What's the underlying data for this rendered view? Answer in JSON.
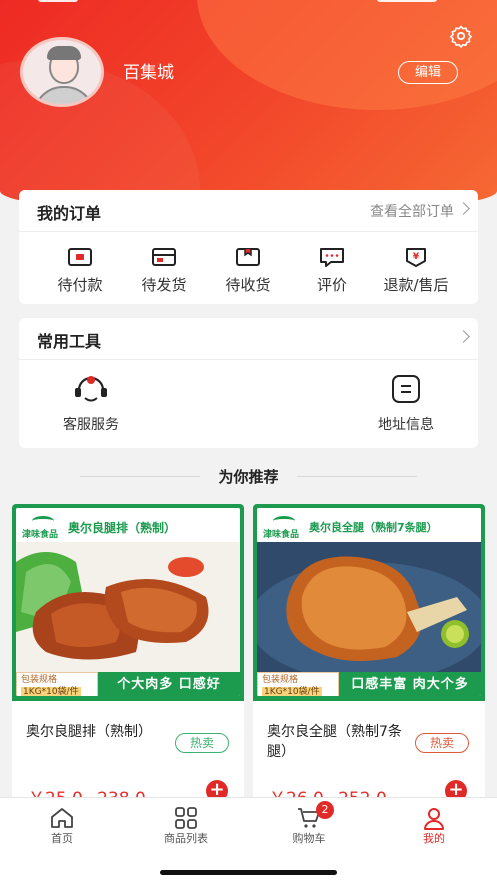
{
  "header": {
    "shop_name": "百集城",
    "edit_label": "编辑",
    "settings_icon": "gear-icon",
    "colors": {
      "start": "#ee2a24",
      "end": "#f66a34"
    }
  },
  "orders": {
    "title": "我的订单",
    "see_all": "查看全部订单",
    "items": [
      {
        "label": "待付款",
        "icon": "wallet-icon"
      },
      {
        "label": "待发货",
        "icon": "card-icon"
      },
      {
        "label": "待收货",
        "icon": "box-icon"
      },
      {
        "label": "评价",
        "icon": "comment-icon"
      },
      {
        "label": "退款/售后",
        "icon": "refund-icon"
      }
    ]
  },
  "tools": {
    "title": "常用工具",
    "items": [
      {
        "label": "客服服务",
        "icon": "customer-service-icon"
      },
      {
        "label": "地址信息",
        "icon": "address-icon"
      }
    ]
  },
  "recommend": {
    "title": "为你推荐",
    "products": [
      {
        "brand": "津味食品",
        "image_title": "奥尔良腿排（熟制）",
        "spec_line1": "包装规格",
        "spec_line2": "1KG*10袋/件",
        "slogan": "个大肉多 口感好",
        "name": "奥尔良腿排（熟制）",
        "tag": "热卖",
        "tag_color": "#3cb371",
        "price": "￥25.0~238.0"
      },
      {
        "brand": "津味食品",
        "image_title": "奥尔良全腿（熟制7条腿）",
        "spec_line1": "包装规格",
        "spec_line2": "1KG*10袋/件",
        "slogan": "口感丰富 肉大个多",
        "name": "奥尔良全腿（熟制7条腿）",
        "tag": "热卖",
        "tag_color": "#e05a3a",
        "price": "￥26.0~252.0"
      }
    ]
  },
  "tabbar": {
    "items": [
      {
        "label": "首页",
        "icon": "home-icon"
      },
      {
        "label": "商品列表",
        "icon": "grid-icon"
      },
      {
        "label": "购物车",
        "icon": "cart-icon",
        "badge": "2"
      },
      {
        "label": "我的",
        "icon": "user-icon",
        "active": true
      }
    ],
    "active_color": "#e02a27"
  }
}
